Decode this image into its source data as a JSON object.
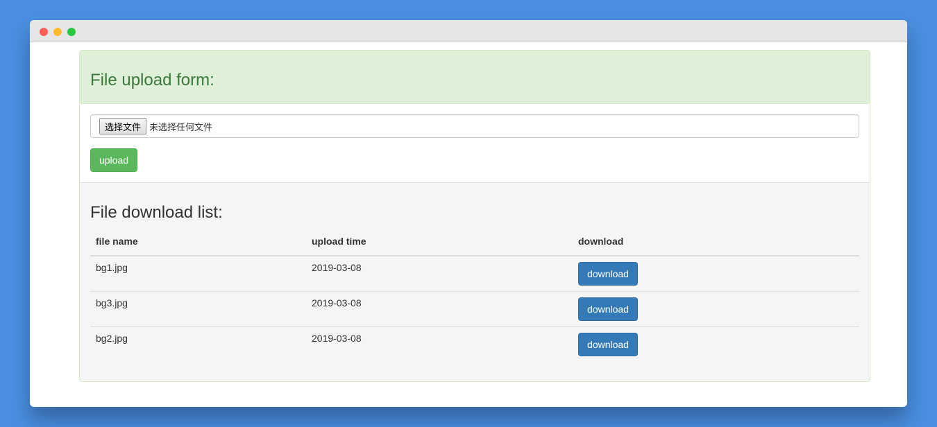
{
  "upload_section": {
    "title": "File upload form:",
    "choose_file_label": "选择文件",
    "no_file_text": "未选择任何文件",
    "upload_label": "upload"
  },
  "download_section": {
    "title": "File download list:",
    "columns": [
      "file name",
      "upload time",
      "download"
    ],
    "rows": [
      {
        "file_name": "bg1.jpg",
        "upload_time": "2019-03-08",
        "action": "download"
      },
      {
        "file_name": "bg3.jpg",
        "upload_time": "2019-03-08",
        "action": "download"
      },
      {
        "file_name": "bg2.jpg",
        "upload_time": "2019-03-08",
        "action": "download"
      }
    ]
  },
  "colors": {
    "background": "#4a8fe2",
    "success": "#5cb85c",
    "primary": "#337ab7",
    "heading_green": "#3c763d"
  }
}
